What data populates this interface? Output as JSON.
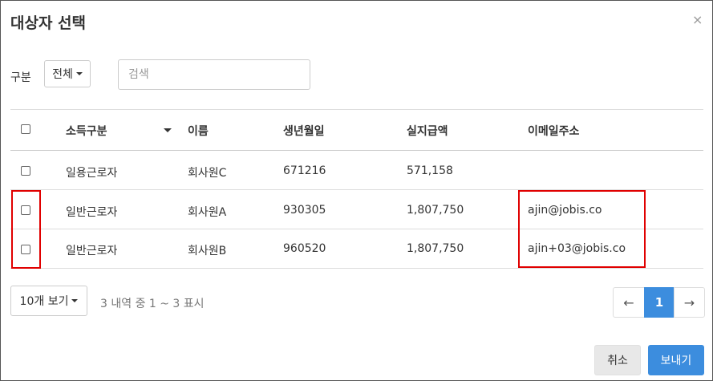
{
  "dialog": {
    "title": "대상자 선택",
    "close": "×"
  },
  "filter": {
    "label": "구분",
    "selected": "전체",
    "search_placeholder": "검색"
  },
  "table": {
    "headers": {
      "type": "소득구분",
      "name": "이름",
      "birth": "생년월일",
      "pay": "실지급액",
      "email": "이메일주소"
    },
    "rows": [
      {
        "type": "일용근로자",
        "name": "회사원C",
        "birth": "671216",
        "pay": "571,158",
        "email": ""
      },
      {
        "type": "일반근로자",
        "name": "회사원A",
        "birth": "930305",
        "pay": "1,807,750",
        "email": "ajin@jobis.co"
      },
      {
        "type": "일반근로자",
        "name": "회사원B",
        "birth": "960520",
        "pay": "1,807,750",
        "email": "ajin+03@jobis.co"
      }
    ]
  },
  "footer": {
    "page_size": "10개 보기",
    "info": "3 내역 중 1 ~ 3 표시",
    "prev": "←",
    "current_page": "1",
    "next": "→"
  },
  "buttons": {
    "cancel": "취소",
    "send": "보내기"
  },
  "colors": {
    "primary": "#3c8dde",
    "highlight": "#e00000"
  }
}
